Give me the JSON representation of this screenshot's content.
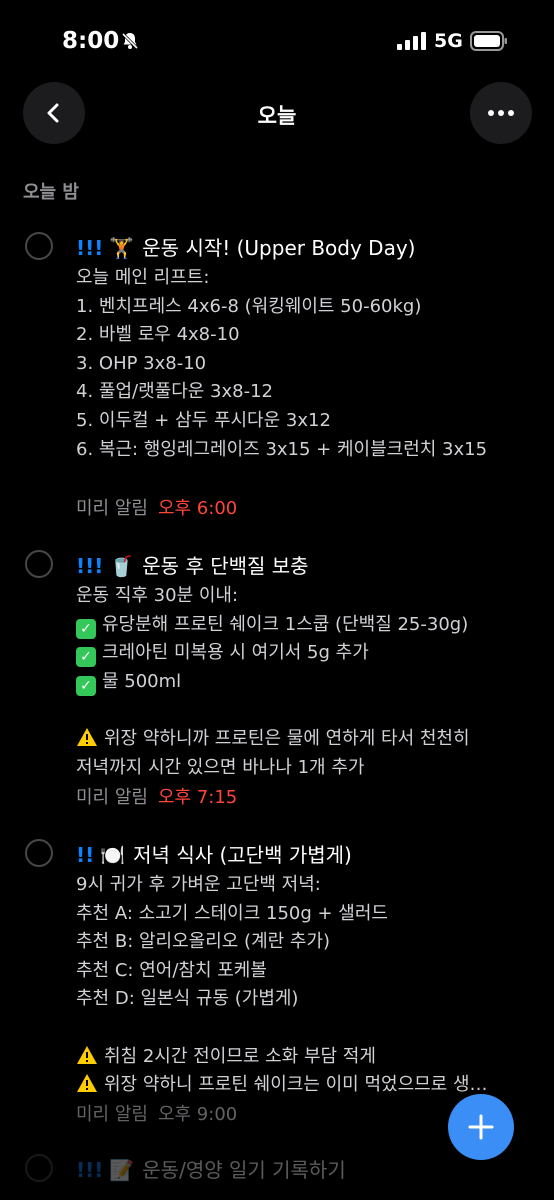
{
  "status": {
    "time": "8:00",
    "network": "5G"
  },
  "header": {
    "title": "오늘"
  },
  "section": {
    "label": "오늘 밤"
  },
  "items": [
    {
      "priority": "!!!",
      "emoji": "🏋️",
      "title": "운동 시작! (Upper Body Day)",
      "notes": [
        "오늘 메인 리프트:",
        "1. 벤치프레스 4x6-8 (워킹웨이트 50-60kg)",
        "2. 바벨 로우 4x8-10",
        "3. OHP 3x8-10",
        "4. 풀업/랫풀다운 3x8-12",
        "5. 이두컬 + 삼두 푸시다운 3x12",
        "6. 복근: 행잉레그레이즈 3x15 + 케이블크런치 3x15"
      ],
      "alert_label": "미리 알림",
      "alert_time": "오후 6:00"
    },
    {
      "priority": "!!!",
      "emoji": "🥤",
      "title": "운동 후 단백질 보충",
      "notes_header": "운동 직후 30분 이내:",
      "checks": [
        "유당분해 프로틴 쉐이크 1스쿱 (단백질 25-30g)",
        "크레아틴 미복용 시 여기서 5g 추가",
        "물 500ml"
      ],
      "warnings": [
        "위장 약하니까 프로틴은 물에 연하게 타서 천천히"
      ],
      "extra": "저녁까지 시간 있으면 바나나 1개 추가",
      "alert_label": "미리 알림",
      "alert_time": "오후 7:15"
    },
    {
      "priority": "!!",
      "emoji": "🍽️",
      "title": "저녁 식사 (고단백 가볍게)",
      "notes": [
        "9시 귀가 후 가벼운 고단백 저녁:",
        "추천 A: 소고기 스테이크 150g + 샐러드",
        "추천 B: 알리오올리오 (계란 추가)",
        "추천 C: 연어/참치 포케볼",
        "추천 D: 일본식 규동 (가볍게)"
      ],
      "warnings": [
        "취침 2시간 전이므로 소화 부담 적게",
        "위장 약하니 프로틴 쉐이크는 이미 먹었으므로 생…"
      ],
      "alert_label": "미리 알림",
      "alert_time": "오후 9:00"
    },
    {
      "priority": "!!!",
      "emoji": "📝",
      "title": "운동/영양 일기 기록하기"
    }
  ],
  "icons": {
    "back": "chevron-left-icon",
    "more": "ellipsis-icon",
    "add": "plus-icon"
  },
  "colors": {
    "background": "#000000",
    "priority": "#0a84ff",
    "alert_time": "#ff453a",
    "fab": "#3a8ef6",
    "check_mark": "#34c759",
    "warning": "#ffcc00"
  }
}
